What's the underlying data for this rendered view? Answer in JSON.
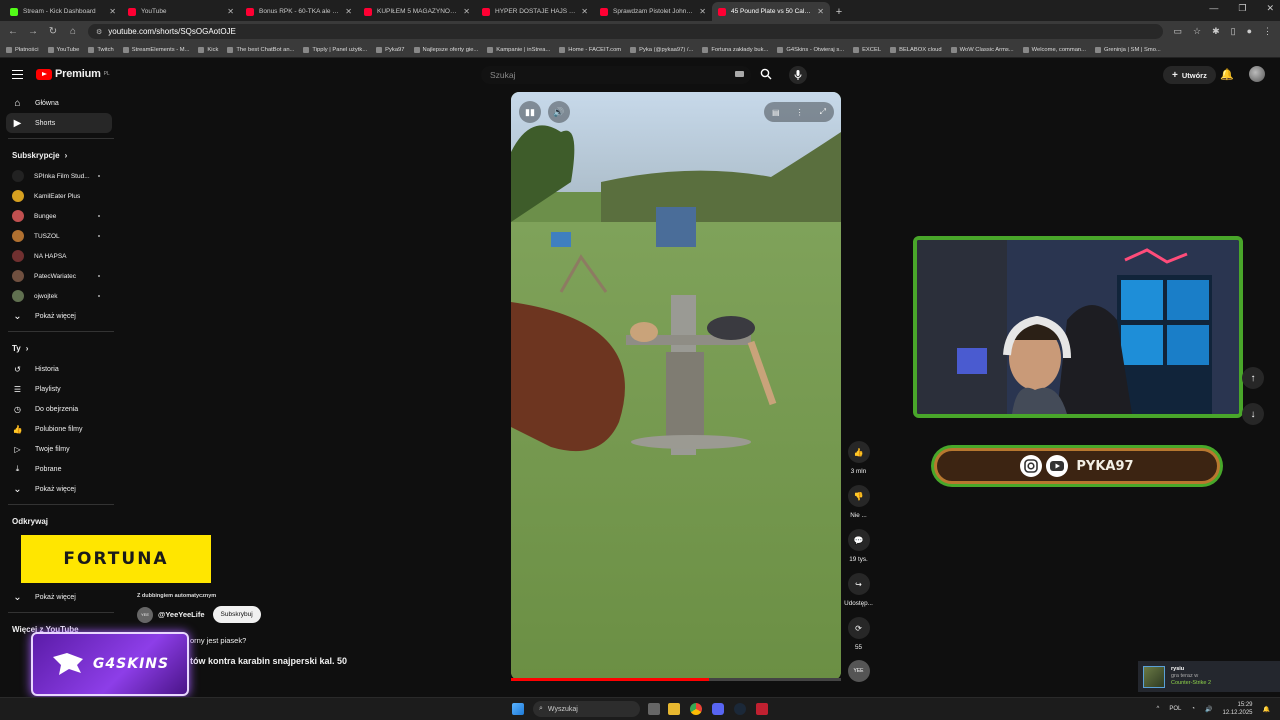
{
  "browser": {
    "tabs": [
      {
        "label": "Stream - Kick Dashboard",
        "color": "#53fc18",
        "active": false
      },
      {
        "label": "YouTube",
        "color": "#ff0033",
        "active": false
      },
      {
        "label": "Bonus RPK - 60-TKA ale to LAS...",
        "color": "#ff0033",
        "active": false
      },
      {
        "label": "KUPIŁEM 5 MAGAZYNÓW I ZA...",
        "color": "#ff0033",
        "active": false
      },
      {
        "label": "HYPER DOSTAJE HAJS OD FALC...",
        "color": "#ff0033",
        "active": false
      },
      {
        "label": "Sprawdzam Pistolet Johna Wic...",
        "color": "#ff0033",
        "active": false
      },
      {
        "label": "45 Pound Plate vs 50 Cal S...",
        "color": "#ff0033",
        "active": true
      }
    ],
    "url": "youtube.com/shorts/SQsOGAotOJE",
    "bookmarks": [
      "Płatności",
      "YouTube",
      "Twitch",
      "StreamElements - M...",
      "Kick",
      "The best ChatBot an...",
      "Tipply | Panel użytk...",
      "Pyka97",
      "Najlepsze oferty gie...",
      "Kampanie | inStrea...",
      "Home - FACEIT.com",
      "Pyka (@pykaa97) /...",
      "Fortuna zakłady buk...",
      "G4Skins - Otwieraj s...",
      "EXCEL",
      "BELABOX cloud",
      "WoW Classic Arms...",
      "Welcome, comman...",
      "Greninja | SM | Smo..."
    ]
  },
  "youtube": {
    "logo_label": "Premium",
    "logo_region": "PL",
    "search_placeholder": "Szukaj",
    "create_label": "Utwórz",
    "nav": [
      {
        "label": "Główna",
        "icon": "home-icon",
        "glyph": "⌂",
        "selected": false
      },
      {
        "label": "Shorts",
        "icon": "shorts-icon",
        "glyph": "▶",
        "selected": true
      }
    ],
    "subs_header": "Subskrypcje",
    "subscriptions": [
      {
        "label": "SPInka Film Stud...",
        "color": "#222",
        "live": true
      },
      {
        "label": "KamilEater Plus",
        "color": "#d6a020",
        "live": false
      },
      {
        "label": "Bungee",
        "color": "#c05050",
        "live": true
      },
      {
        "label": "TUSZOL",
        "color": "#b07030",
        "live": true
      },
      {
        "label": "NA HAPSA",
        "color": "#703030",
        "live": false
      },
      {
        "label": "PatecWariatec",
        "color": "#705040",
        "live": true
      },
      {
        "label": "ojwojtek",
        "color": "#607050",
        "live": true
      }
    ],
    "subs_more": "Pokaż więcej",
    "you_header": "Ty",
    "you_items": [
      {
        "label": "Historia",
        "glyph": "↺",
        "icon": "history-icon"
      },
      {
        "label": "Playlisty",
        "glyph": "☰",
        "icon": "playlists-icon"
      },
      {
        "label": "Do obejrzenia",
        "glyph": "◷",
        "icon": "watch-later-icon"
      },
      {
        "label": "Polubione filmy",
        "glyph": "👍",
        "icon": "liked-icon"
      },
      {
        "label": "Twoje filmy",
        "glyph": "▷",
        "icon": "your-videos-icon"
      },
      {
        "label": "Pobrane",
        "glyph": "⤓",
        "icon": "downloads-icon"
      }
    ],
    "you_more": "Pokaż więcej",
    "explore_header": "Odkrywaj",
    "explore_more": "Pokaż więcej",
    "more_header": "Więcej z YouTube"
  },
  "short": {
    "dub_label": "Z dubbingiem automatycznym",
    "channel": "@YeeYeeLife",
    "subscribe": "Subskrybuj",
    "question": "orny jest piasek?",
    "title": "tów kontra karabin snajperski kal. 50",
    "progress_fraction": 0.6,
    "actions": [
      {
        "icon": "like-icon",
        "glyph": "👍",
        "label": "3 mln"
      },
      {
        "icon": "dislike-icon",
        "glyph": "👎",
        "label": "Nie ..."
      },
      {
        "icon": "comments-icon",
        "glyph": "💬",
        "label": "19 tys."
      },
      {
        "icon": "share-icon",
        "glyph": "↪",
        "label": "Udostęp..."
      },
      {
        "icon": "remix-icon",
        "glyph": "⟳",
        "label": "55"
      }
    ]
  },
  "overlays": {
    "fortuna": "FORTUNA",
    "g4skins": "G4SKINS",
    "streamer": "PYKA97",
    "steam_name": "rysiu",
    "steam_status": "gra teraz w",
    "steam_game": "Counter-Strike 2"
  },
  "taskbar": {
    "search": "Wyszukaj",
    "lang": "POL",
    "time": "15:29",
    "date": "12.12.2025"
  }
}
